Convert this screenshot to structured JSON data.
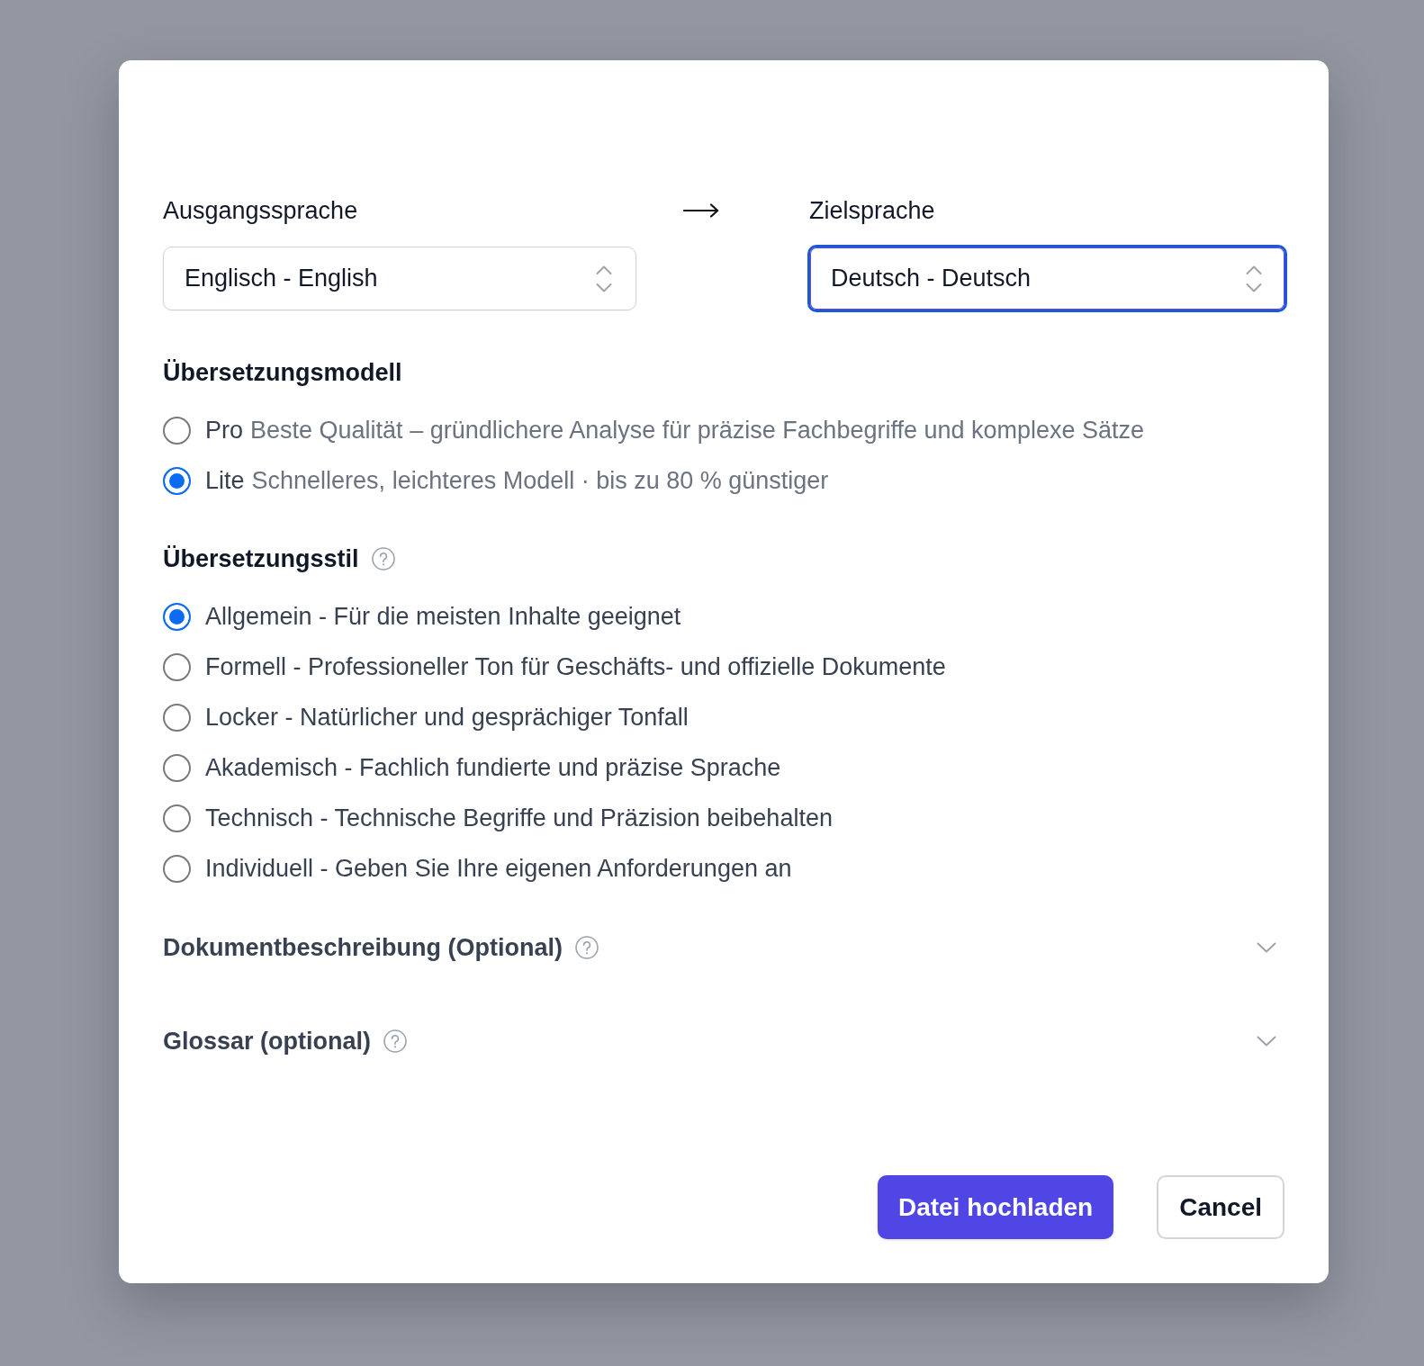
{
  "source_language": {
    "label": "Ausgangssprache",
    "value": "Englisch - English",
    "focused": false
  },
  "target_language": {
    "label": "Zielsprache",
    "value": "Deutsch - Deutsch",
    "focused": true
  },
  "translation_model": {
    "title": "Übersetzungsmodell",
    "options": [
      {
        "name": "Pro",
        "description": "Beste Qualität – gründlichere Analyse für präzise Fachbegriffe und komplexe Sätze",
        "selected": false
      },
      {
        "name": "Lite",
        "description": "Schnelleres, leichteres Modell · bis zu 80 % günstiger",
        "selected": true
      }
    ]
  },
  "translation_style": {
    "title": "Übersetzungsstil",
    "options": [
      {
        "label": "Allgemein - Für die meisten Inhalte geeignet",
        "selected": true
      },
      {
        "label": "Formell - Professioneller Ton für Geschäfts- und offizielle Dokumente",
        "selected": false
      },
      {
        "label": "Locker - Natürlicher und gesprächiger Tonfall",
        "selected": false
      },
      {
        "label": "Akademisch - Fachlich fundierte und präzise Sprache",
        "selected": false
      },
      {
        "label": "Technisch - Technische Begriffe und Präzision beibehalten",
        "selected": false
      },
      {
        "label": "Individuell - Geben Sie Ihre eigenen Anforderungen an",
        "selected": false
      }
    ]
  },
  "sections": [
    {
      "title": "Dokumentbeschreibung (Optional)",
      "expanded": false
    },
    {
      "title": "Glossar (optional)",
      "expanded": false
    }
  ],
  "buttons": [
    {
      "label": "Datei hochladen",
      "kind": "primary"
    },
    {
      "label": "Cancel",
      "kind": "secondary"
    }
  ]
}
